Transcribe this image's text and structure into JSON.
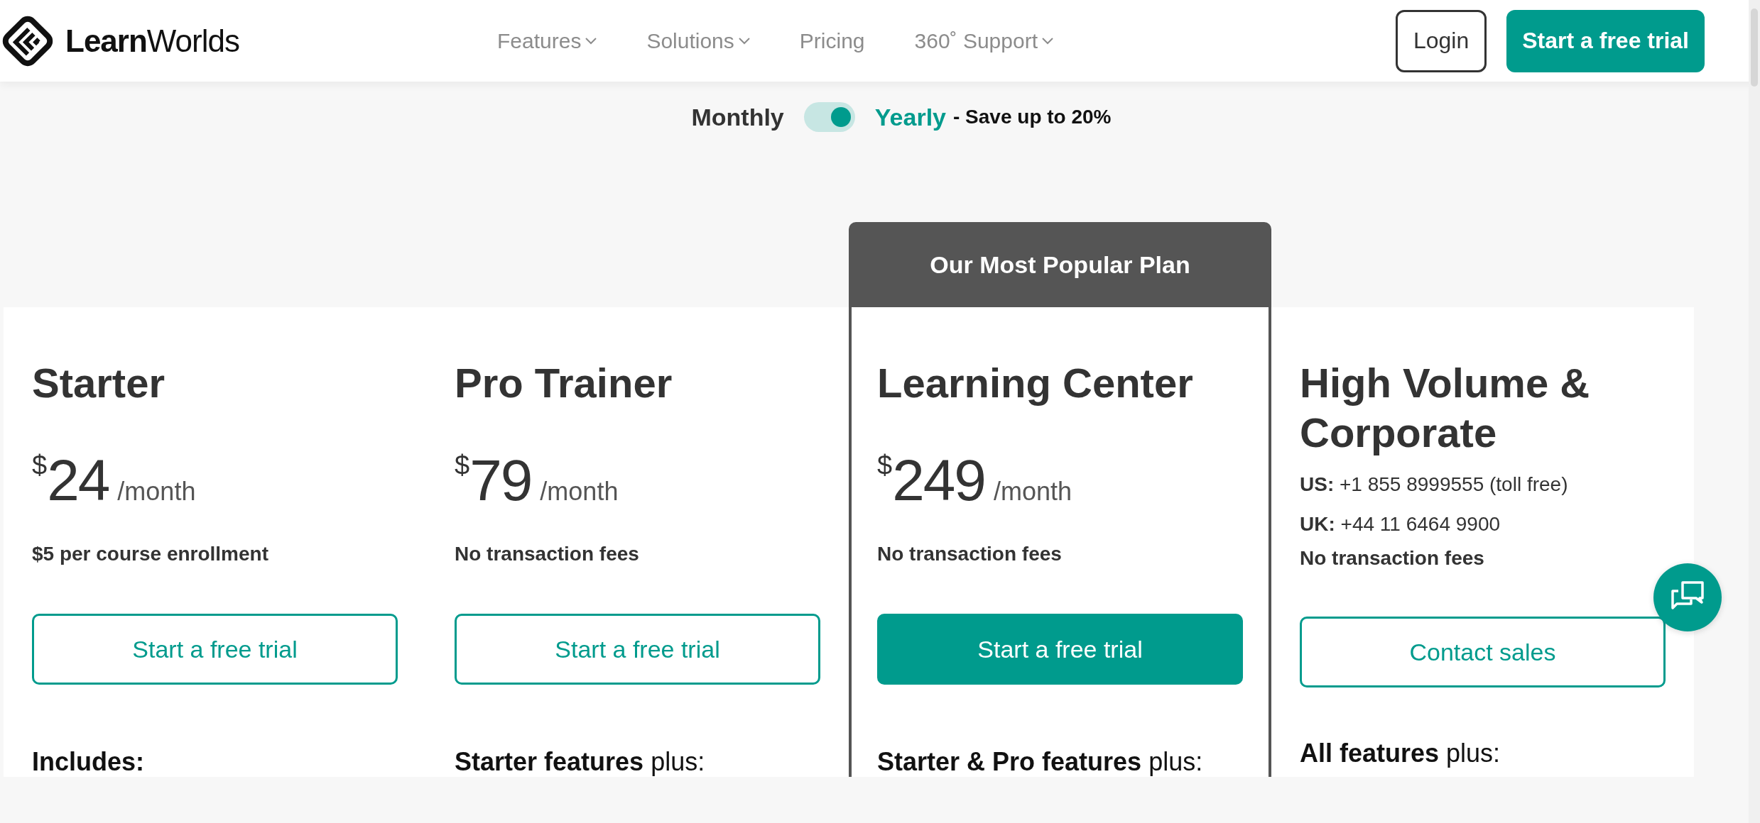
{
  "header": {
    "logo": "**Learn**Worlds",
    "nav": [
      {
        "label": "Features",
        "dropdown": true
      },
      {
        "label": "Solutions",
        "dropdown": true
      },
      {
        "label": "Pricing",
        "dropdown": false
      },
      {
        "label": "360˚ Support",
        "dropdown": true
      }
    ],
    "login": "Login",
    "cta": "Start a free trial"
  },
  "billing": {
    "options": [
      {
        "label": "Monthly",
        "selected": false
      },
      {
        "label": "Yearly",
        "selected": true
      }
    ],
    "note": "- Save up to 20%"
  },
  "plans": [
    {
      "kind": "priced",
      "popular": false,
      "title": "Starter",
      "currency": "$",
      "amount": "24",
      "period": "/month",
      "notes": [
        "$5 per course enrollment"
      ],
      "button": {
        "label": "Start a free trial",
        "primary": false
      },
      "features_heading": "**Includes:**"
    },
    {
      "kind": "priced",
      "popular": false,
      "title": "Pro Trainer",
      "currency": "$",
      "amount": "79",
      "period": "/month",
      "notes": [
        "No transaction fees"
      ],
      "button": {
        "label": "Start a free trial",
        "primary": false
      },
      "features_heading": "**Starter features** plus:"
    },
    {
      "kind": "priced",
      "popular": true,
      "popular_label": "Our Most Popular Plan",
      "title": "Learning Center",
      "currency": "$",
      "amount": "249",
      "period": "/month",
      "notes": [
        "No transaction fees"
      ],
      "button": {
        "label": "Start a free trial",
        "primary": true
      },
      "features_heading": "**Starter & Pro features** plus:"
    },
    {
      "kind": "contact",
      "popular": false,
      "title": "High Volume & Corporate",
      "contacts": [
        "**US:** +1 855 8999555 (toll free)",
        "**UK:** +44 11 6464 9900"
      ],
      "notes": [
        "No transaction fees"
      ],
      "button": {
        "label": "Contact sales",
        "primary": false
      },
      "features_heading": "**All features** plus:"
    }
  ]
}
